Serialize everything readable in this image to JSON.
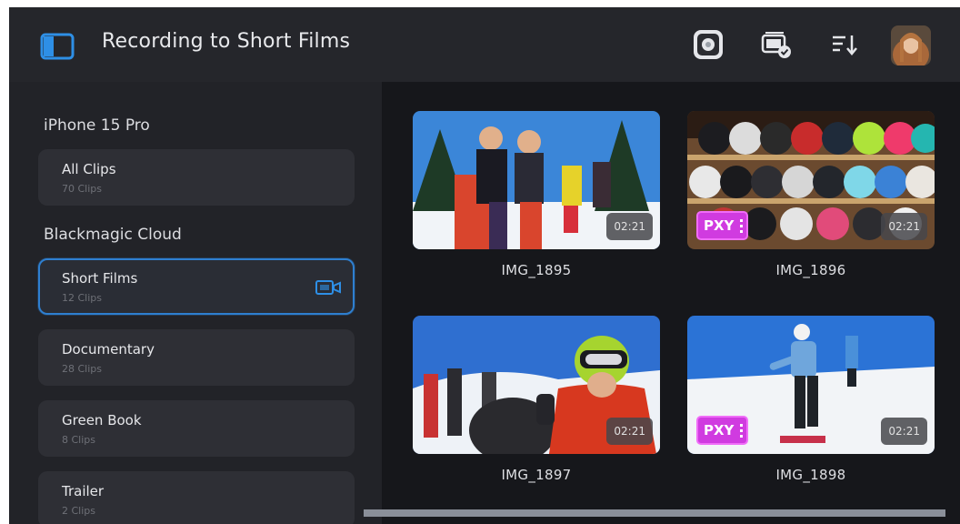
{
  "header": {
    "title": "Recording to Short Films",
    "icons": [
      "sidebar-toggle-icon",
      "cloud-sync-icon",
      "clips-check-icon",
      "sort-icon",
      "avatar"
    ]
  },
  "sidebar": {
    "sections": [
      {
        "title": "iPhone 15 Pro",
        "cards": [
          {
            "name": "All Clips",
            "count": "70 Clips",
            "selected": false
          }
        ]
      },
      {
        "title": "Blackmagic Cloud",
        "cards": [
          {
            "name": "Short Films",
            "count": "12 Clips",
            "selected": true
          },
          {
            "name": "Documentary",
            "count": "28 Clips",
            "selected": false
          },
          {
            "name": "Green Book",
            "count": "8 Clips",
            "selected": false
          },
          {
            "name": "Trailer",
            "count": "2 Clips",
            "selected": false
          }
        ]
      }
    ]
  },
  "clips": [
    {
      "name": "IMG_1895",
      "duration": "02:21",
      "proxy": false
    },
    {
      "name": "IMG_1896",
      "duration": "02:21",
      "proxy": true,
      "proxy_label": "PXY"
    },
    {
      "name": "IMG_1897",
      "duration": "02:21",
      "proxy": false
    },
    {
      "name": "IMG_1898",
      "duration": "02:21",
      "proxy": true,
      "proxy_label": "PXY"
    }
  ],
  "colors": {
    "accent": "#2e7fd0",
    "proxy_badge": "#d03be0",
    "background": "#1c1d21"
  }
}
